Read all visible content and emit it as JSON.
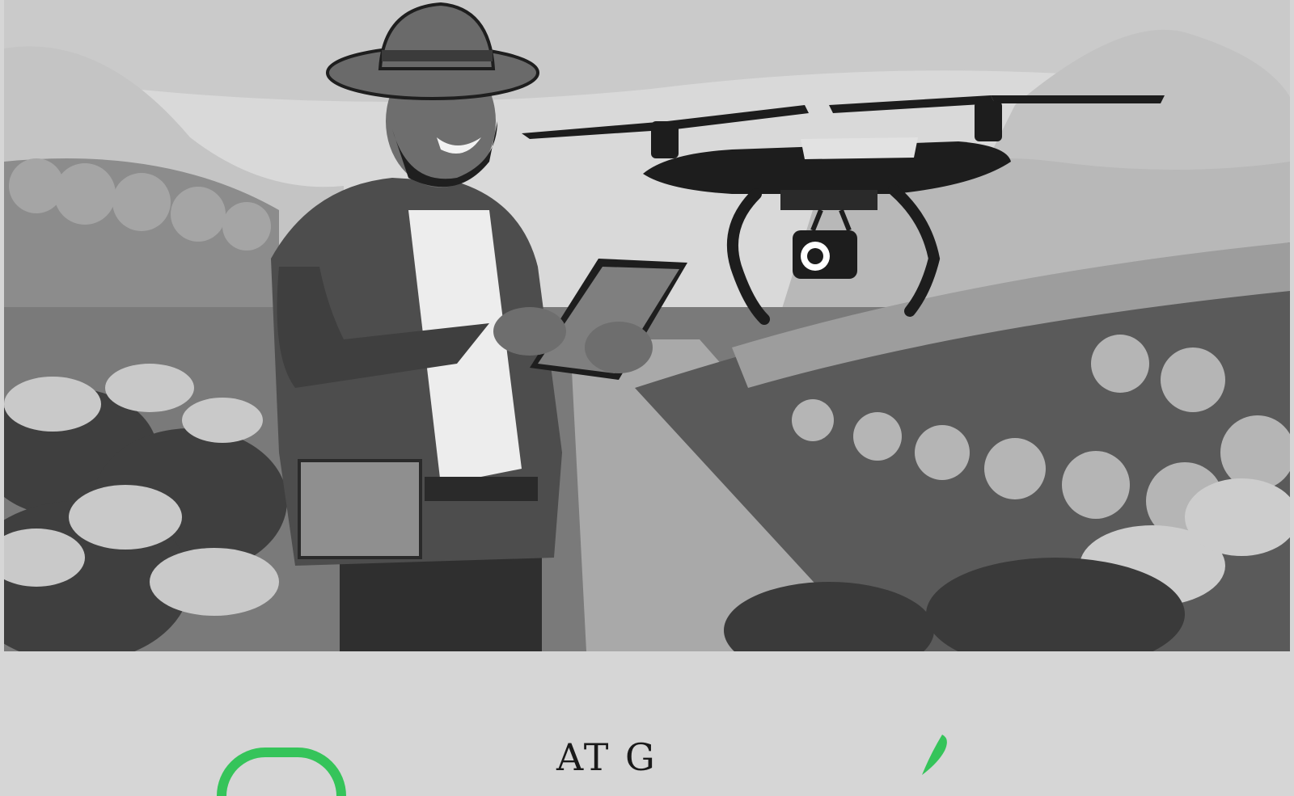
{
  "image": {
    "description_visible": false
  },
  "logo_strip": {
    "text": "AT G",
    "ring_color": "#35c45a",
    "leaf_color": "#35c45a",
    "background": "#d6d6d6"
  },
  "palette": {
    "sky": "#dcdcdc",
    "mountain": "#bdbdbd",
    "vine_dark": "#4a4a4a",
    "vine_light": "#bfbfbf",
    "drone": "#1d1d1d",
    "shirt": "#555555",
    "skin": "#6e6e6e"
  }
}
